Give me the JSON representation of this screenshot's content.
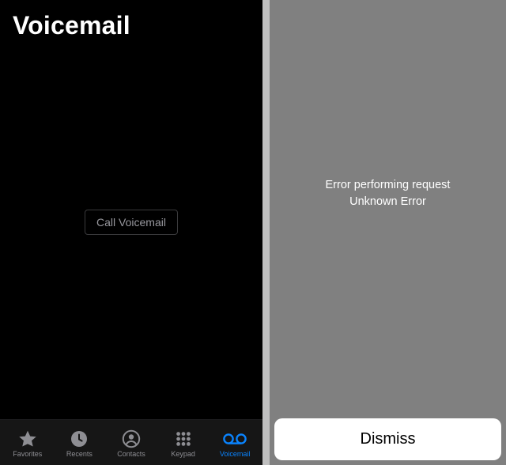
{
  "left": {
    "title": "Voicemail",
    "call_button_label": "Call Voicemail",
    "tabs": [
      {
        "label": "Favorites"
      },
      {
        "label": "Recents"
      },
      {
        "label": "Contacts"
      },
      {
        "label": "Keypad"
      },
      {
        "label": "Voicemail"
      }
    ],
    "active_tab_index": 4
  },
  "right": {
    "error_line1": "Error performing request",
    "error_line2": "Unknown Error",
    "dismiss_label": "Dismiss"
  },
  "colors": {
    "accent": "#0a84ff",
    "inactive": "#8e8e93",
    "modal_bg": "#808080"
  }
}
